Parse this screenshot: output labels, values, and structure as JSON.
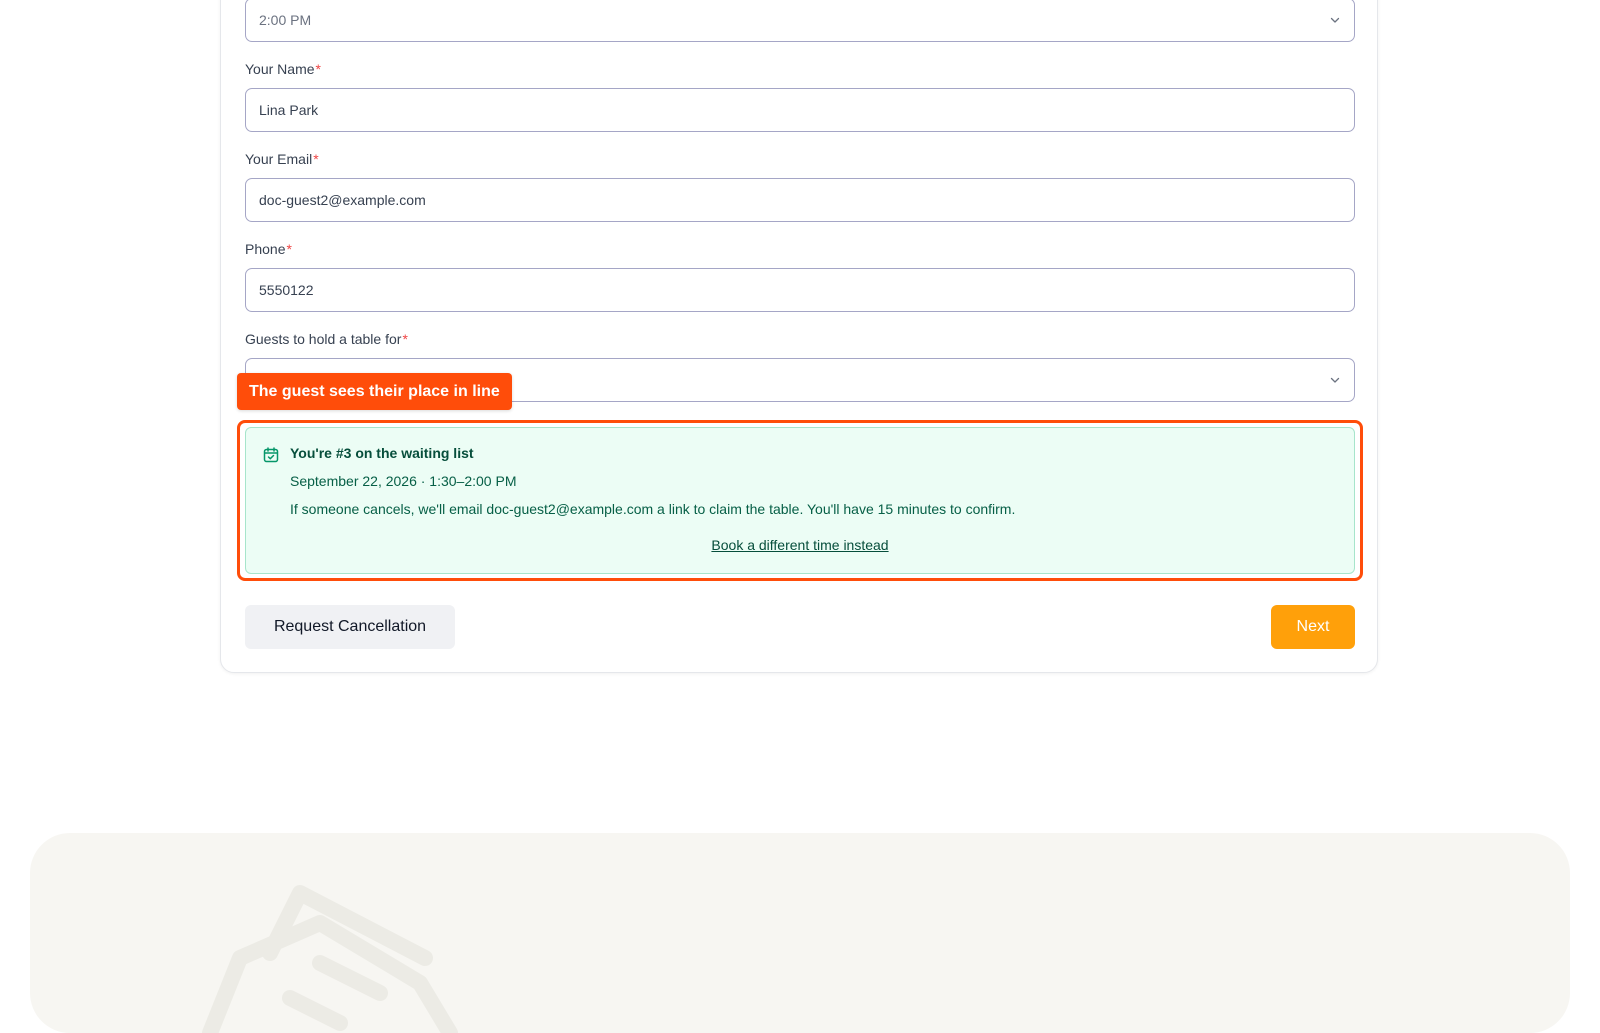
{
  "form": {
    "time_select": {
      "value": "2:00 PM"
    },
    "name": {
      "label": "Your Name",
      "required_mark": "*",
      "value": "Lina Park"
    },
    "email": {
      "label": "Your Email",
      "required_mark": "*",
      "value": "doc-guest2@example.com"
    },
    "phone": {
      "label": "Phone",
      "required_mark": "*",
      "value": "5550122"
    },
    "guests": {
      "label": "Guests to hold a table for",
      "required_mark": "*",
      "value": ""
    }
  },
  "annotation": {
    "tooltip": "The guest sees their place in line",
    "color": "#ff4d0a"
  },
  "waitlist_notice": {
    "title": "You're #3 on the waiting list",
    "slot": "September 22, 2026 · 1:30–2:00 PM",
    "message": "If someone cancels, we'll email doc-guest2@example.com a link to claim the table. You'll have 15 minutes to confirm.",
    "link": "Book a different time instead",
    "icon": "calendar-check-icon",
    "bg_color": "#ecfdf5"
  },
  "actions": {
    "cancel_label": "Request Cancellation",
    "next_label": "Next",
    "next_color": "#ffa00a"
  }
}
